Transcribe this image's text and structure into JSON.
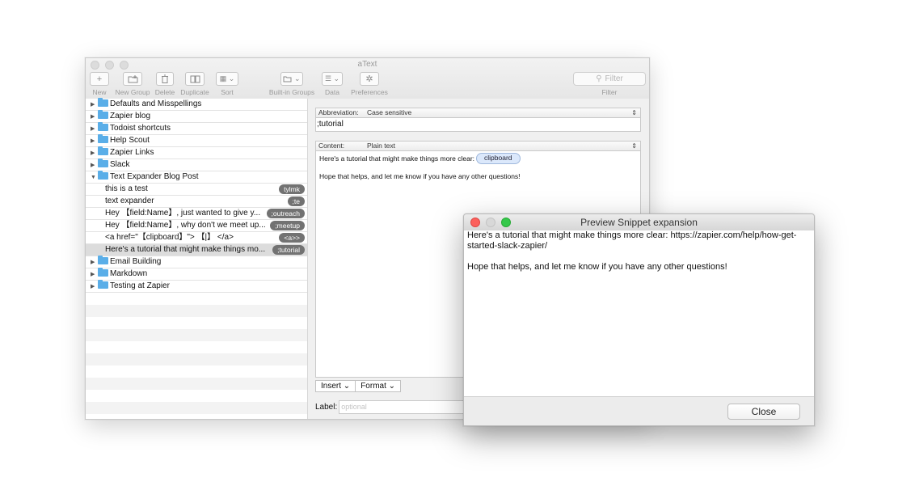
{
  "app": {
    "title": "aText"
  },
  "toolbar": {
    "new_label": "New",
    "new_group_label": "New Group",
    "delete_label": "Delete",
    "duplicate_label": "Duplicate",
    "sort_label": "Sort",
    "builtin_label": "Built-in Groups",
    "data_label": "Data",
    "prefs_label": "Preferences",
    "filter_placeholder": "Filter",
    "filter_label": "Filter"
  },
  "sidebar": {
    "groups_top": [
      {
        "name": "Defaults and Misspellings"
      },
      {
        "name": "Zapier blog"
      },
      {
        "name": "Todoist shortcuts"
      },
      {
        "name": "Help Scout"
      },
      {
        "name": "Zapier Links"
      },
      {
        "name": "Slack"
      }
    ],
    "open_group": {
      "name": "Text Expander Blog Post"
    },
    "snippets": [
      {
        "text": "this is a test",
        "abbr": "tylmk"
      },
      {
        "text": "text expander",
        "abbr": ";te"
      },
      {
        "text": "Hey 【field:Name】, just wanted to give y...",
        "abbr": ";outreach"
      },
      {
        "text": "Hey 【field:Name】, why don't we meet up...",
        "abbr": ";meetup"
      },
      {
        "text": "<a href=\"【clipboard】\"> 【|】 </a>",
        "abbr": "<a>>"
      },
      {
        "text": "Here's a tutorial that might make things mo...",
        "abbr": ";tutorial"
      }
    ],
    "groups_bottom": [
      {
        "name": "Email Building"
      },
      {
        "name": "Markdown"
      },
      {
        "name": "Testing at Zapier"
      }
    ]
  },
  "editor": {
    "abbr_key": "Abbreviation:",
    "abbr_mode": "Case sensitive",
    "abbr_value": ";tutorial",
    "content_key": "Content:",
    "content_mode": "Plain text",
    "content_line1": "Here's a tutorial that might make things more clear:",
    "content_token": "clipboard",
    "content_line2": "Hope that helps, and let me know if you have any other questions!",
    "insert_label": "Insert",
    "format_label": "Format",
    "label_key": "Label:",
    "label_placeholder": "optional"
  },
  "preview": {
    "title": "Preview Snippet expansion",
    "line1": "Here's a tutorial that might make things more clear: https://zapier.com/help/how-get-started-slack-zapier/",
    "line2": "Hope that helps, and let me know if you have any other questions!",
    "close_label": "Close"
  }
}
